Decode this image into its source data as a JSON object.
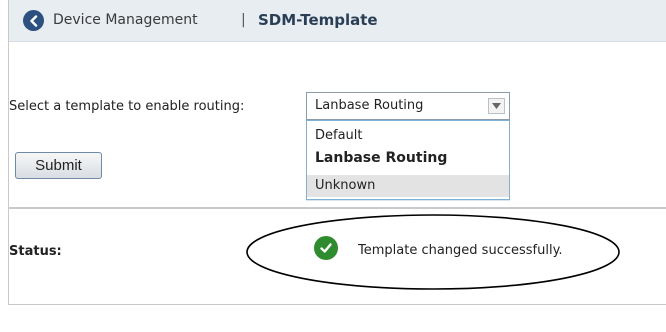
{
  "header": {
    "back_icon": "chevron-left-icon",
    "breadcrumb_parent": "Device Management",
    "separator": "|",
    "breadcrumb_current": "SDM-Template"
  },
  "form": {
    "select_label": "Select a template to enable routing:",
    "selected_value": "Lanbase Routing",
    "options": [
      "Default",
      "Lanbase Routing",
      "Unknown"
    ],
    "submit_label": "Submit"
  },
  "status": {
    "label": "Status:",
    "icon": "checkmark-icon",
    "message": "Template changed successfully.",
    "color": "#2e8b2e"
  },
  "colors": {
    "header_bg": "#e8edf2",
    "accent": "#2c5080"
  }
}
